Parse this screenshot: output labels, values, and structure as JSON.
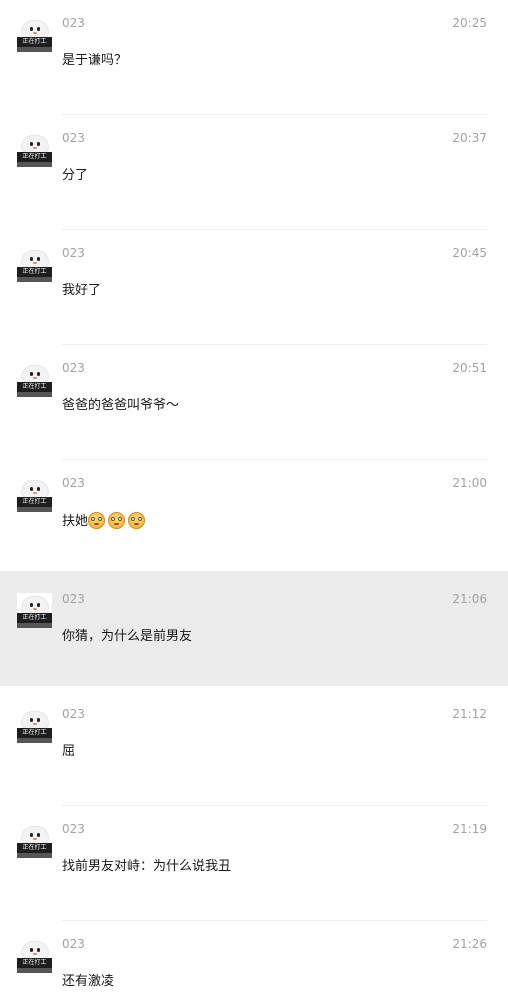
{
  "messages": [
    {
      "sender": "023",
      "avatar_caption": "正在打工",
      "time": "20:25",
      "text": "是于谦吗？"
    },
    {
      "sender": "023",
      "avatar_caption": "正在打工",
      "time": "20:37",
      "text": "分了"
    },
    {
      "sender": "023",
      "avatar_caption": "正在打工",
      "time": "20:45",
      "text": "我好了"
    },
    {
      "sender": "023",
      "avatar_caption": "正在打工",
      "time": "20:51",
      "text": "爸爸的爸爸叫爷爷～"
    },
    {
      "sender": "023",
      "avatar_caption": "正在打工",
      "time": "21:00",
      "text": "扶她",
      "emojis": [
        "flushed-face-emoji",
        "flushed-face-emoji",
        "flushed-face-emoji"
      ]
    },
    {
      "sender": "023",
      "avatar_caption": "正在打工",
      "time": "21:06",
      "text": "你猜，为什么是前男友",
      "highlighted": true
    },
    {
      "sender": "023",
      "avatar_caption": "正在打工",
      "time": "21:12",
      "text": "屈"
    },
    {
      "sender": "023",
      "avatar_caption": "正在打工",
      "time": "21:19",
      "text": "找前男友对峙：为什么说我丑"
    },
    {
      "sender": "023",
      "avatar_caption": "正在打工",
      "time": "21:26",
      "text": "还有激凌"
    }
  ]
}
